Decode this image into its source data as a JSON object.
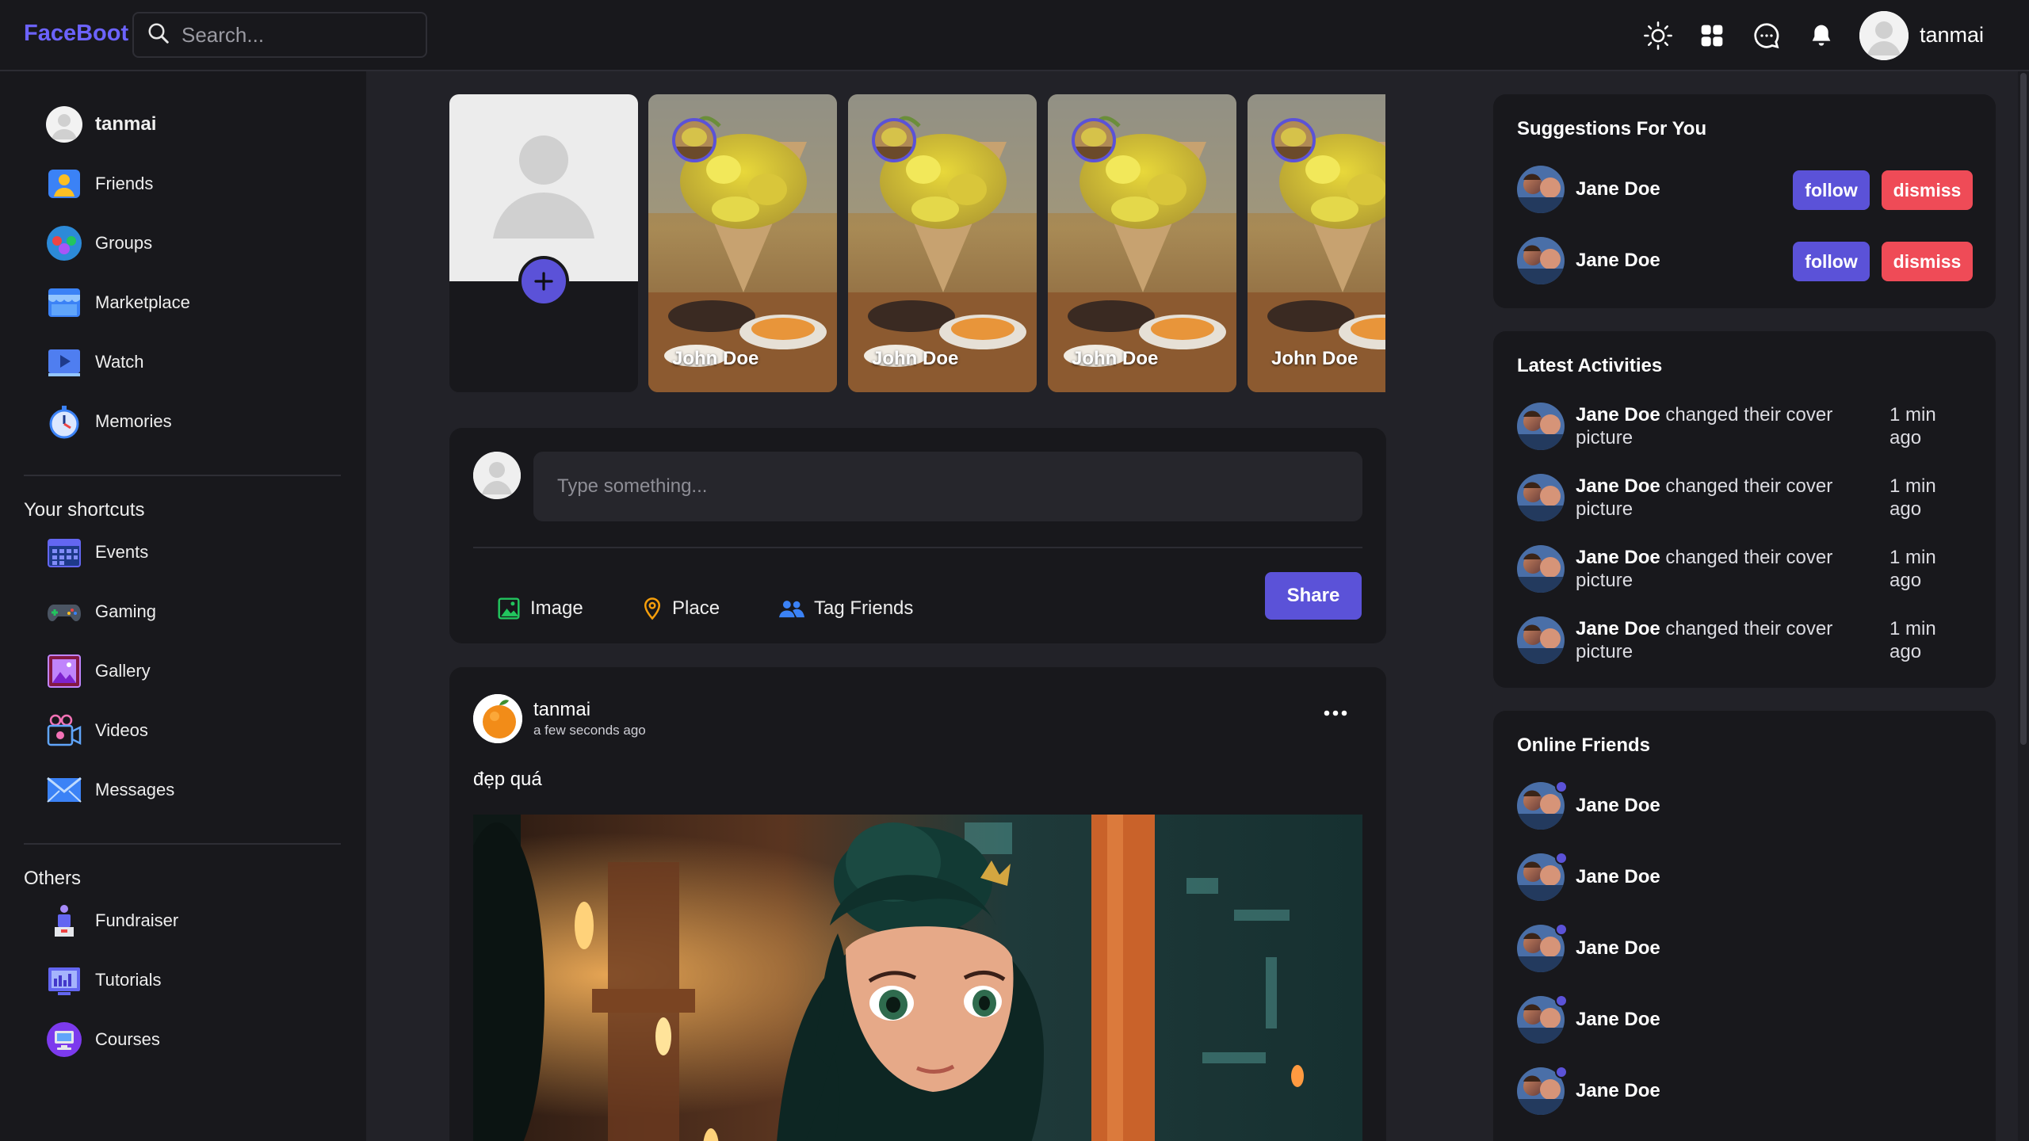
{
  "brand": {
    "logo": "FaceBoot",
    "accent": "#6c63ff"
  },
  "search": {
    "placeholder": "Search..."
  },
  "navbar": {
    "icons": [
      "theme-sun-icon",
      "apps-grid-icon",
      "chat-icon",
      "bell-icon"
    ],
    "user": "tanmai"
  },
  "left_sidebar": {
    "user": "tanmai",
    "menu": [
      {
        "label": "Friends",
        "icon": "friends-icon"
      },
      {
        "label": "Groups",
        "icon": "groups-icon"
      },
      {
        "label": "Marketplace",
        "icon": "marketplace-icon"
      },
      {
        "label": "Watch",
        "icon": "watch-icon"
      },
      {
        "label": "Memories",
        "icon": "memories-icon"
      }
    ],
    "shortcuts_heading": "Your shortcuts",
    "shortcuts": [
      {
        "label": "Events",
        "icon": "events-icon"
      },
      {
        "label": "Gaming",
        "icon": "gaming-icon"
      },
      {
        "label": "Gallery",
        "icon": "gallery-icon"
      },
      {
        "label": "Videos",
        "icon": "videos-icon"
      },
      {
        "label": "Messages",
        "icon": "messages-icon"
      }
    ],
    "others_heading": "Others",
    "others": [
      {
        "label": "Fundraiser",
        "icon": "fundraiser-icon"
      },
      {
        "label": "Tutorials",
        "icon": "tutorials-icon"
      },
      {
        "label": "Courses",
        "icon": "courses-icon"
      }
    ]
  },
  "stories": [
    {
      "name": "John Doe"
    },
    {
      "name": "John Doe"
    },
    {
      "name": "John Doe"
    },
    {
      "name": "John Doe"
    }
  ],
  "composer": {
    "placeholder": "Type something...",
    "actions": [
      {
        "label": "Image",
        "icon": "image-icon"
      },
      {
        "label": "Place",
        "icon": "map-pin-icon"
      },
      {
        "label": "Tag Friends",
        "icon": "tag-friends-icon"
      }
    ],
    "share_label": "Share"
  },
  "post": {
    "author": "tanmai",
    "time": "a few seconds ago",
    "text": "đẹp quá"
  },
  "suggestions": {
    "title": "Suggestions For You",
    "items": [
      {
        "name": "Jane Doe",
        "follow": "follow",
        "dismiss": "dismiss"
      },
      {
        "name": "Jane Doe",
        "follow": "follow",
        "dismiss": "dismiss"
      }
    ]
  },
  "activities": {
    "title": "Latest Activities",
    "items": [
      {
        "name": "Jane Doe",
        "action": "changed their cover picture",
        "time": "1 min ago"
      },
      {
        "name": "Jane Doe",
        "action": "changed their cover picture",
        "time": "1 min ago"
      },
      {
        "name": "Jane Doe",
        "action": "changed their cover picture",
        "time": "1 min ago"
      },
      {
        "name": "Jane Doe",
        "action": "changed their cover picture",
        "time": "1 min ago"
      }
    ]
  },
  "online_friends": {
    "title": "Online Friends",
    "items": [
      {
        "name": "Jane Doe"
      },
      {
        "name": "Jane Doe"
      },
      {
        "name": "Jane Doe"
      },
      {
        "name": "Jane Doe"
      },
      {
        "name": "Jane Doe"
      }
    ]
  },
  "colors": {
    "primary": "#5b52d8",
    "danger": "#ef4b57",
    "bg": "#222228",
    "surface": "#18181c"
  }
}
